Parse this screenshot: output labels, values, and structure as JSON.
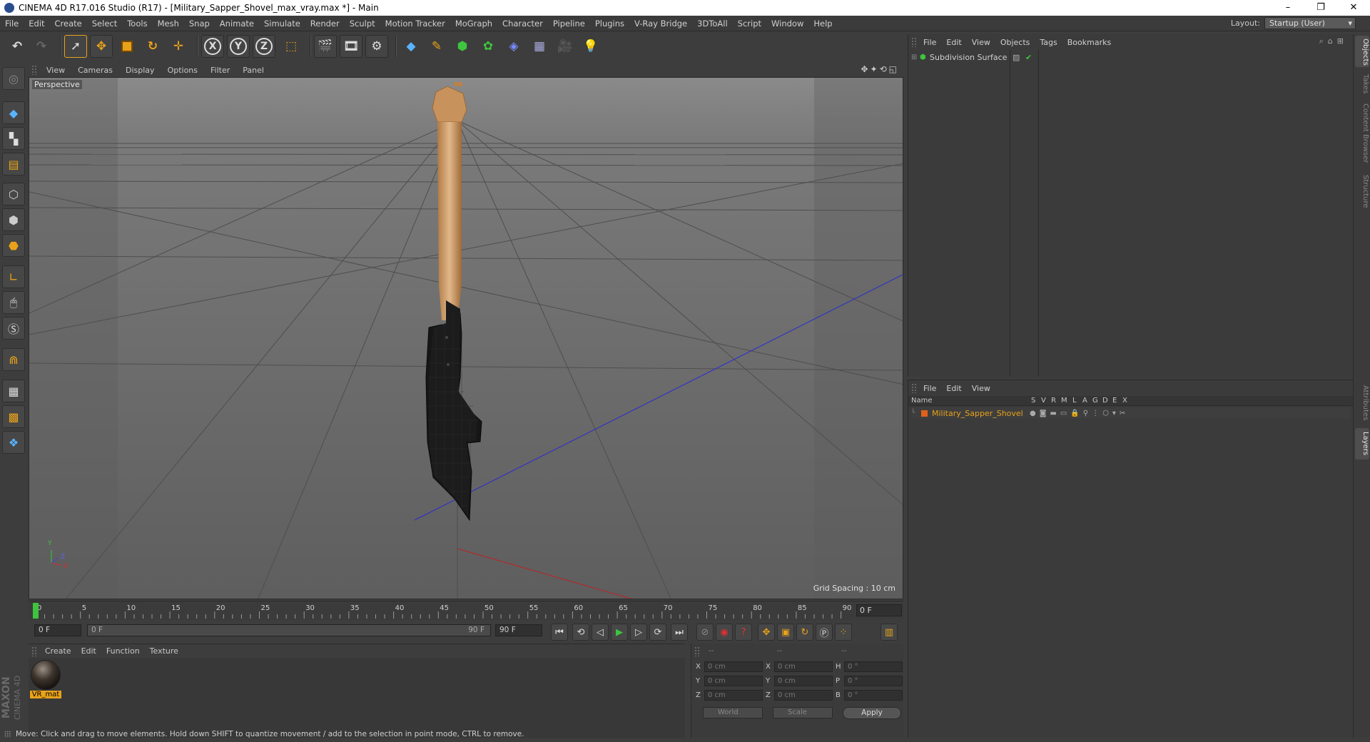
{
  "window": {
    "title": "CINEMA 4D R17.016 Studio (R17) - [Military_Sapper_Shovel_max_vray.max *] - Main",
    "controls": [
      "–",
      "❐",
      "✕"
    ]
  },
  "menu": [
    "File",
    "Edit",
    "Create",
    "Select",
    "Tools",
    "Mesh",
    "Snap",
    "Animate",
    "Simulate",
    "Render",
    "Sculpt",
    "Motion Tracker",
    "MoGraph",
    "Character",
    "Pipeline",
    "Plugins",
    "V-Ray Bridge",
    "3DToAll",
    "Script",
    "Window",
    "Help"
  ],
  "layout": {
    "label": "Layout:",
    "value": "Startup (User)"
  },
  "toolbar": {
    "axis_x": "X",
    "axis_y": "Y",
    "axis_z": "Z"
  },
  "viewport": {
    "menu": [
      "View",
      "Cameras",
      "Display",
      "Options",
      "Filter",
      "Panel"
    ],
    "camera_label": "Perspective",
    "grid_spacing": "Grid Spacing : 10 cm",
    "axis_labels": {
      "x": "X",
      "y": "Y",
      "z": "Z"
    }
  },
  "timeline": {
    "ticks": [
      "0",
      "5",
      "10",
      "15",
      "20",
      "25",
      "30",
      "35",
      "40",
      "45",
      "50",
      "55",
      "60",
      "65",
      "70",
      "75",
      "80",
      "85",
      "90"
    ],
    "current_frame": "0 F"
  },
  "transport": {
    "start_field": "0 F",
    "range_start": "0 F",
    "range_end": "90 F",
    "end_field": "90 F"
  },
  "material_manager": {
    "menu": [
      "Create",
      "Edit",
      "Function",
      "Texture"
    ],
    "materials": [
      {
        "name": "VR_mat"
      }
    ]
  },
  "branding": {
    "line1": "MAXON",
    "line2": "CINEMA 4D"
  },
  "coordinates": {
    "headers": [
      "--",
      "--",
      "--"
    ],
    "rows": [
      {
        "pos_label": "X",
        "pos": "0 cm",
        "size_label": "X",
        "size": "0 cm",
        "rot_label": "H",
        "rot": "0 °"
      },
      {
        "pos_label": "Y",
        "pos": "0 cm",
        "size_label": "Y",
        "size": "0 cm",
        "rot_label": "P",
        "rot": "0 °"
      },
      {
        "pos_label": "Z",
        "pos": "0 cm",
        "size_label": "Z",
        "size": "0 cm",
        "rot_label": "B",
        "rot": "0 °"
      }
    ],
    "space": "World",
    "mode": "Scale",
    "apply": "Apply"
  },
  "status": "Move: Click and drag to move elements. Hold down SHIFT to quantize movement / add to the selection in point mode, CTRL to remove.",
  "object_manager": {
    "menu": [
      "File",
      "Edit",
      "View",
      "Objects",
      "Tags",
      "Bookmarks"
    ],
    "objects": [
      {
        "name": "Subdivision Surface"
      }
    ]
  },
  "layer_manager": {
    "menu": [
      "File",
      "Edit",
      "View"
    ],
    "columns": {
      "name": "Name",
      "flags": [
        "S",
        "V",
        "R",
        "M",
        "L",
        "A",
        "G",
        "D",
        "E",
        "X"
      ]
    },
    "layers": [
      {
        "name": "Military_Sapper_Shovel",
        "color": "#e0601a"
      }
    ]
  },
  "right_tabs": [
    "Objects",
    "Takes",
    "Content Browser",
    "Structure",
    "Attributes",
    "Layers"
  ],
  "colors": {
    "accent": "#e8a21a",
    "layer_text": "#e8a21a",
    "play_green": "#3ec43e"
  }
}
